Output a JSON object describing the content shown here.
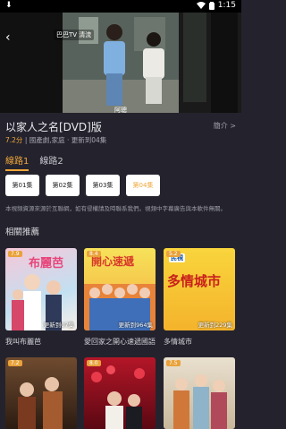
{
  "status_bar": {
    "left_icon": "download-icon",
    "time": "1:15"
  },
  "player": {
    "channel_logo": "巴巴TV 清流",
    "subtitle": "阿聰"
  },
  "show": {
    "title": "以家人之名[DVD]版",
    "synopsis_link": "簡介 >",
    "score": "7.2分",
    "meta_rest": " | 國產劇,家庭 · 更新到04集",
    "tabs": [
      {
        "label": "線路1"
      },
      {
        "label": "線路2"
      }
    ],
    "episodes": [
      {
        "label": "第01集"
      },
      {
        "label": "第02集"
      },
      {
        "label": "第03集"
      },
      {
        "label": "第04集"
      }
    ],
    "notice": "本視頻資源來源於互聯網，如有侵權請及時聯系我們。視頻中字幕廣告與本軟件無關。"
  },
  "recommend": {
    "heading": "相關推薦",
    "items": [
      {
        "title": "我叫布麗芭",
        "score": "7.9",
        "update": "更新到07集",
        "poster_text": "布麗芭"
      },
      {
        "title": "愛回家之開心速遞國語",
        "score": "8.4",
        "update": "更新到964集",
        "poster_text": "開心速遞"
      },
      {
        "title": "多情城市",
        "score": "5.2",
        "update": "更新到229集",
        "poster_text": "多情城市",
        "poster_logo": "民視"
      },
      {
        "title": "",
        "score": "7.2",
        "update": "",
        "poster_text": ""
      },
      {
        "title": "",
        "score": "8.0",
        "update": "",
        "poster_text": ""
      },
      {
        "title": "",
        "score": "7.5",
        "update": "",
        "poster_text": ""
      }
    ]
  }
}
